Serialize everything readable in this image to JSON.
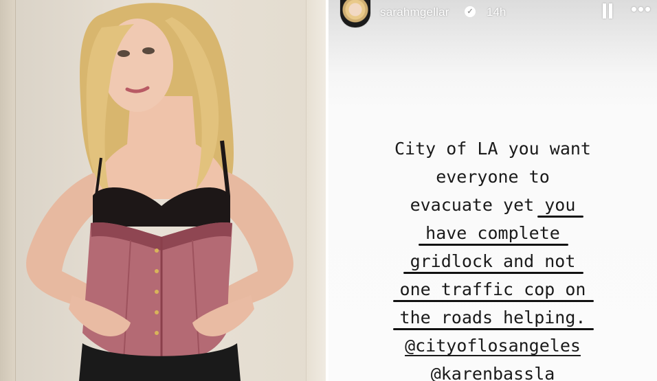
{
  "photo": {
    "description_icon": "portrait-photo"
  },
  "story": {
    "username": "sarahmgellar",
    "verified_icon": "verified-badge-icon",
    "timestamp": "14h",
    "pause_icon": "pause-icon",
    "more_icon": "more-options-icon",
    "lines": [
      "City of LA you want",
      "everyone to",
      "evacuate yet ",
      "you",
      "have complete",
      "gridlock and not",
      "one traffic cop on",
      "the roads helping.",
      "@cityoflosangeles",
      "@karenbassla"
    ]
  },
  "colors": {
    "story_background": "#fbfbfb",
    "text": "#1a1a1a",
    "header_text": "#ffffff"
  }
}
